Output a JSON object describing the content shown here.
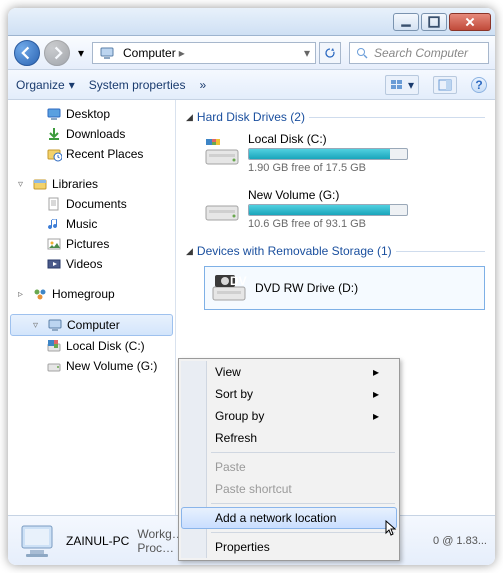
{
  "titlebar": {},
  "nav": {
    "breadcrumb": "Computer",
    "arrow": "▸",
    "search_placeholder": "Search Computer"
  },
  "toolbar": {
    "organize": "Organize",
    "sysprops": "System properties",
    "more": "»"
  },
  "sidebar": [
    {
      "label": "Desktop",
      "icon": "desktop",
      "lvl": 1
    },
    {
      "label": "Downloads",
      "icon": "downloads",
      "lvl": 1
    },
    {
      "label": "Recent Places",
      "icon": "recent",
      "lvl": 1
    },
    {
      "sep": true
    },
    {
      "label": "Libraries",
      "icon": "libraries",
      "lvl": 0,
      "exp": "▿"
    },
    {
      "label": "Documents",
      "icon": "documents",
      "lvl": 1
    },
    {
      "label": "Music",
      "icon": "music",
      "lvl": 1
    },
    {
      "label": "Pictures",
      "icon": "pictures",
      "lvl": 1
    },
    {
      "label": "Videos",
      "icon": "videos",
      "lvl": 1
    },
    {
      "sep": true
    },
    {
      "label": "Homegroup",
      "icon": "homegroup",
      "lvl": 0,
      "exp": "▹"
    },
    {
      "sep": true
    },
    {
      "label": "Computer",
      "icon": "computer",
      "lvl": 0,
      "exp": "▿",
      "sel": true
    },
    {
      "label": "Local Disk (C:)",
      "icon": "localdisk",
      "lvl": 1
    },
    {
      "label": "New Volume (G:)",
      "icon": "volume",
      "lvl": 1
    }
  ],
  "groups": {
    "hdd": {
      "title": "Hard Disk Drives (2)",
      "tri": "◢"
    },
    "rem": {
      "title": "Devices with Removable Storage (1)",
      "tri": "◢"
    }
  },
  "drives": [
    {
      "name": "Local Disk (C:)",
      "free": "1.90 GB free of 17.5 GB",
      "pct": 89,
      "sys": true
    },
    {
      "name": "New Volume (G:)",
      "free": "10.6 GB free of 93.1 GB",
      "pct": 89
    }
  ],
  "removable": {
    "name": "DVD RW Drive (D:)"
  },
  "details": {
    "name": "ZAINUL-PC",
    "l1": "Workg…",
    "l2": "Proc…",
    "right": "0 @ 1.83..."
  },
  "ctx": [
    {
      "label": "View",
      "sub": true
    },
    {
      "label": "Sort by",
      "sub": true
    },
    {
      "label": "Group by",
      "sub": true
    },
    {
      "label": "Refresh"
    },
    {
      "sep": true
    },
    {
      "label": "Paste",
      "disabled": true
    },
    {
      "label": "Paste shortcut",
      "disabled": true
    },
    {
      "sep": true
    },
    {
      "label": "Add a network location",
      "sel": true
    },
    {
      "sep": true
    },
    {
      "label": "Properties"
    }
  ]
}
